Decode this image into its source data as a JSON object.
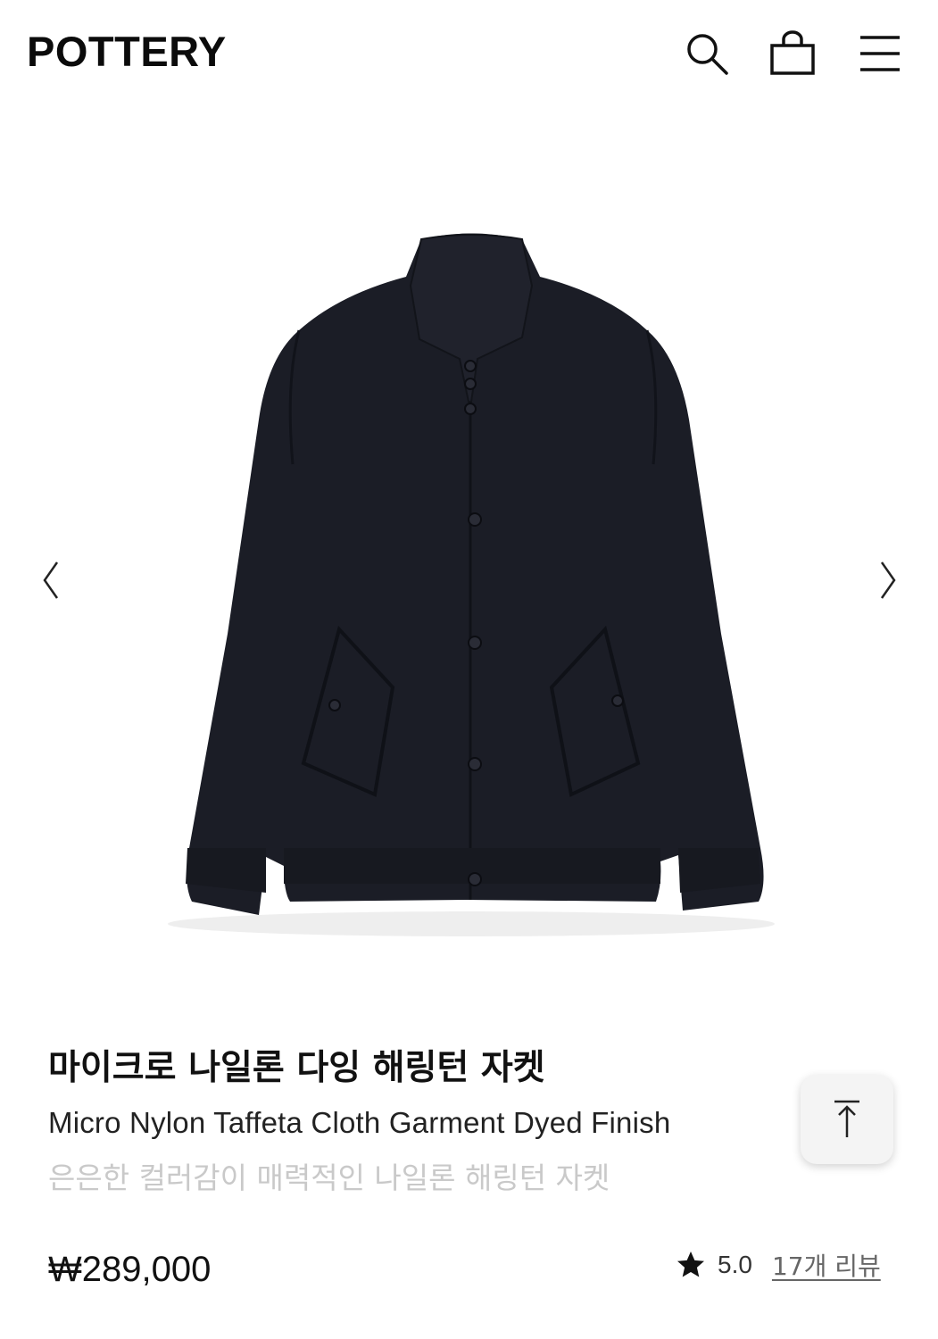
{
  "header": {
    "logo": "POTTERY",
    "icons": [
      "search-icon",
      "shopping-bag-icon",
      "hamburger-menu-icon"
    ]
  },
  "gallery": {
    "image_alt": "Black nylon harrington jacket",
    "prev_icon": "chevron-left-icon",
    "next_icon": "chevron-right-icon"
  },
  "product": {
    "name_ko": "마이크로 나일론 다잉 해링턴 자켓",
    "name_en": "Micro Nylon Taffeta Cloth Garment Dyed Finish",
    "subtitle": "은은한 컬러감이 매력적인 나일론 해링턴 자켓",
    "price": "₩289,000",
    "rating": "5.0",
    "reviews_link": "17개 리뷰"
  },
  "scroll_top": {
    "icon": "arrow-up-to-top-icon"
  },
  "colors": {
    "jacket": "#1b1d26",
    "subtitle_text": "#c9c9c9",
    "button_bg": "#f4f4f4"
  }
}
